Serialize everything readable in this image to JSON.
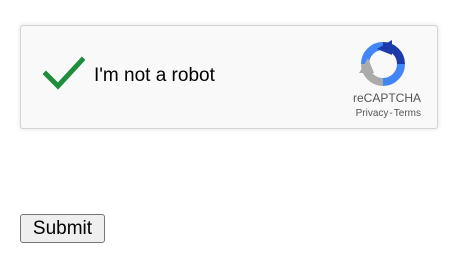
{
  "captcha": {
    "checked": true,
    "label": "I'm not a robot",
    "brand": "reCAPTCHA",
    "privacy_link": "Privacy",
    "separator": "-",
    "terms_link": "Terms",
    "check_color": "#1e8e3e",
    "logo_icon": "recaptcha-logo-icon"
  },
  "form": {
    "submit_label": "Submit"
  }
}
